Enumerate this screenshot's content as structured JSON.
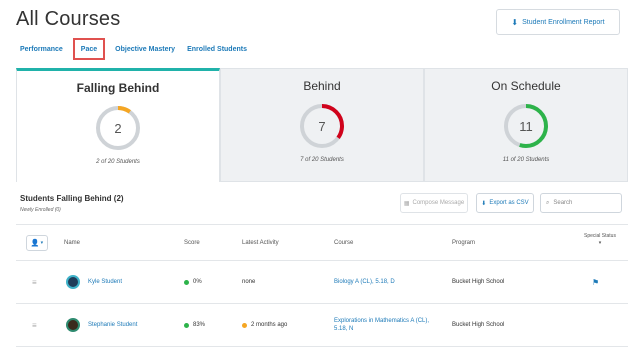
{
  "header": {
    "title": "All Courses",
    "report_button": "Student Enrollment Report",
    "report_icon": "download-icon"
  },
  "tabs": [
    {
      "label": "Performance",
      "active": false
    },
    {
      "label": "Pace",
      "active": true
    },
    {
      "label": "Objective Mastery",
      "active": false
    },
    {
      "label": "Enrolled Students",
      "active": false
    }
  ],
  "summary": [
    {
      "title": "Falling Behind",
      "count": "2",
      "subtitle": "2 of 20 Students",
      "fraction": 0.1,
      "color": "#f5a623",
      "selected": true
    },
    {
      "title": "Behind",
      "count": "7",
      "subtitle": "7 of 20 Students",
      "fraction": 0.35,
      "color": "#d0021b",
      "selected": false
    },
    {
      "title": "On Schedule",
      "count": "11",
      "subtitle": "11 of 20 Students",
      "fraction": 0.55,
      "color": "#2db34a",
      "selected": false
    }
  ],
  "section": {
    "title": "Students Falling Behind (2)",
    "subtitle": "Newly Enrolled (0)"
  },
  "toolbar": {
    "compose": "Compose Message",
    "export": "Export as CSV",
    "search_placeholder": "Search"
  },
  "table": {
    "columns": {
      "name": "Name",
      "score": "Score",
      "activity": "Latest Activity",
      "course": "Course",
      "program": "Program",
      "special_line1": "Special Status",
      "special_line2": "▾"
    },
    "rows": [
      {
        "name": "Kyle Student",
        "score": "0%",
        "score_color": "#2db34a",
        "activity": "none",
        "activity_color": "",
        "course": "Biology A (CL), 5.18, D",
        "program": "Bucket High School",
        "flagged": true
      },
      {
        "name": "Stephanie Student",
        "score": "83%",
        "score_color": "#2db34a",
        "activity": "2 months ago",
        "activity_color": "#f5a623",
        "course": "Explorations in Mathematics A (CL), 5.18, N",
        "program": "Bucket High School",
        "flagged": false
      }
    ]
  }
}
